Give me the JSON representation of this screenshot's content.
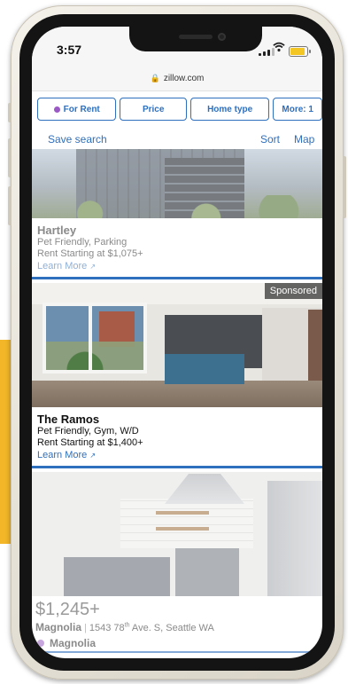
{
  "status_bar": {
    "time": "3:57",
    "url": "zillow.com",
    "lock_icon": "lock-icon",
    "battery_color": "#f3c623"
  },
  "filters": [
    {
      "label": "For Rent",
      "dot_color": "#9b59c6"
    },
    {
      "label": "Price"
    },
    {
      "label": "Home type"
    },
    {
      "label": "More: 1"
    }
  ],
  "actions": {
    "save_search": "Save search",
    "sort": "Sort",
    "map": "Map"
  },
  "listings": [
    {
      "name": "Hartley",
      "amenities": "Pet Friendly, Parking",
      "rent": "Rent Starting at $1,075+",
      "link": "Learn More"
    },
    {
      "name": "The Ramos",
      "amenities": "Pet Friendly, Gym, W/D",
      "rent": "Rent Starting at $1,400+",
      "link": "Learn More",
      "badge": "Sponsored"
    },
    {
      "price": "$1,245+",
      "name": "Magnolia",
      "address_num": "1543 78",
      "address_sup": "th",
      "address_rest": " Ave. S, Seattle WA",
      "brand": "Magnolia"
    }
  ],
  "colors": {
    "accent": "#2e6fbe",
    "side_bar": "#f2b628"
  }
}
